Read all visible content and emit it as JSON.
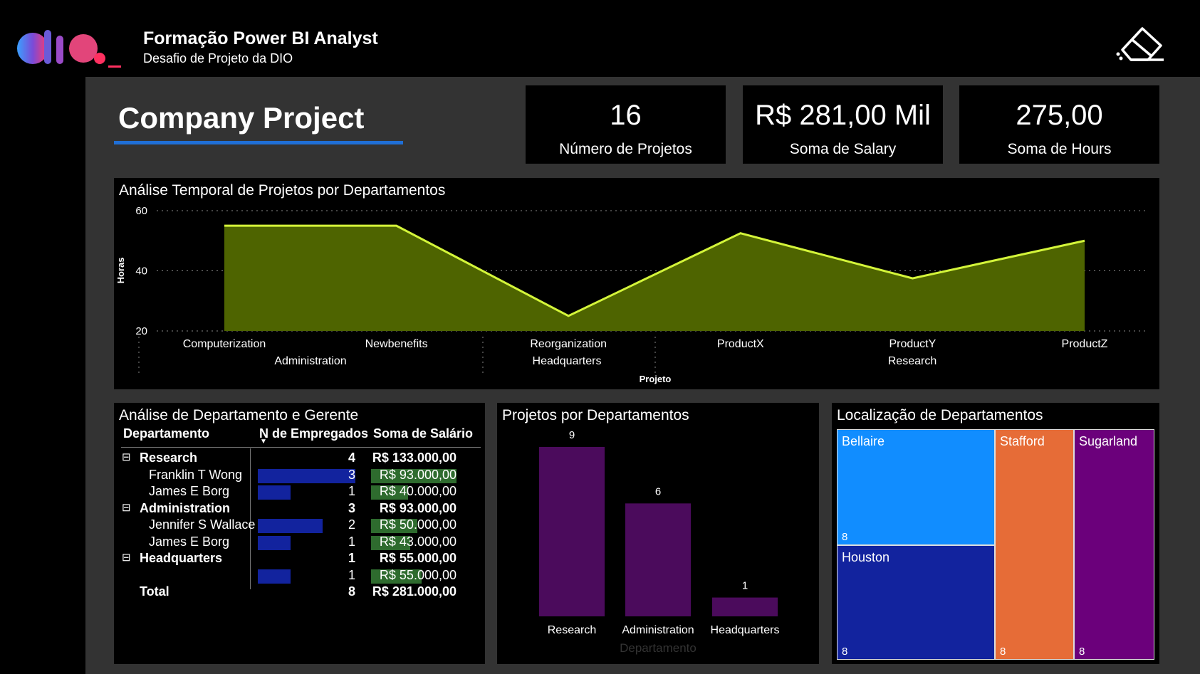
{
  "header": {
    "title": "Formação Power BI Analyst",
    "subtitle": "Desafio de Projeto da DIO",
    "logo_text": "dio",
    "eraser_icon": "eraser-icon"
  },
  "page": {
    "title": "Company Project"
  },
  "kpis": [
    {
      "value": "16",
      "label": "Número de Projetos"
    },
    {
      "value": "R$ 281,00 Mil",
      "label": "Soma de Salary"
    },
    {
      "value": "275,00",
      "label": "Soma de Hours"
    }
  ],
  "area_chart": {
    "title": "Análise Temporal de Projetos por Departamentos",
    "ylabel": "Horas",
    "xlabel": "Projeto",
    "y_ticks": [
      "60",
      "40",
      "20"
    ],
    "x_labels": [
      "Computerization",
      "Newbenefits",
      "Reorganization",
      "ProductX",
      "ProductY",
      "ProductZ"
    ],
    "group_labels": [
      "Administration",
      "Headquarters",
      "Research"
    ]
  },
  "table": {
    "title": "Análise de Departamento e Gerente",
    "columns": [
      "Departamento",
      "N de Empregados",
      "Soma de Salário"
    ],
    "rows": [
      {
        "name": "Research",
        "count": "4",
        "salary": "R$ 133.000,00",
        "level": "group",
        "expand": "⊟"
      },
      {
        "name": "Franklin T Wong",
        "count": "3",
        "salary": "R$ 93.000,00",
        "level": "child",
        "bar": 3,
        "salbar": 93000
      },
      {
        "name": "James E Borg",
        "count": "1",
        "salary": "R$ 40.000,00",
        "level": "child",
        "bar": 1,
        "salbar": 40000
      },
      {
        "name": "Administration",
        "count": "3",
        "salary": "R$ 93.000,00",
        "level": "group",
        "expand": "⊟"
      },
      {
        "name": "Jennifer S Wallace",
        "count": "2",
        "salary": "R$ 50.000,00",
        "level": "child",
        "bar": 2,
        "salbar": 50000
      },
      {
        "name": "James E Borg",
        "count": "1",
        "salary": "R$ 43.000,00",
        "level": "child",
        "bar": 1,
        "salbar": 43000
      },
      {
        "name": "Headquarters",
        "count": "1",
        "salary": "R$ 55.000,00",
        "level": "group",
        "expand": "⊟"
      },
      {
        "name": "",
        "count": "1",
        "salary": "R$ 55.000,00",
        "level": "child",
        "bar": 1,
        "salbar": 55000
      }
    ],
    "total": {
      "name": "Total",
      "count": "8",
      "salary": "R$ 281.000,00"
    }
  },
  "bar_chart": {
    "title": "Projetos por Departamentos",
    "xlabel": "Departamento"
  },
  "treemap": {
    "title": "Localização de Departamentos",
    "tiles": [
      {
        "name": "Bellaire",
        "count": "8",
        "color": "#118DFF"
      },
      {
        "name": "Houston",
        "count": "8",
        "color": "#12239E"
      },
      {
        "name": "Stafford",
        "count": "8",
        "color": "#E66C37"
      },
      {
        "name": "Sugarland",
        "count": "8",
        "color": "#6B007B"
      }
    ]
  },
  "colors": {
    "background": "#000000",
    "canvas": "#333333",
    "accent_line": "#D4F53A",
    "area_fill": "#4E6400",
    "bar_purple": "#4B0B5C",
    "table_bar_blue": "#12239E",
    "table_bar_green": "#2E6B2E",
    "title_underline": "#1F6FD6"
  },
  "chart_data": [
    {
      "type": "area",
      "title": "Análise Temporal de Projetos por Departamentos",
      "xlabel": "Projeto",
      "ylabel": "Horas",
      "categories": [
        "Computerization",
        "Administration",
        "Newbenefits",
        "Reorganization",
        "ProductX",
        "ProductY",
        "ProductZ"
      ],
      "values": [
        55,
        55,
        25,
        52.5,
        37.5,
        50
      ],
      "x": [
        "Computerization",
        "Newbenefits",
        "Reorganization",
        "ProductX",
        "ProductY",
        "ProductZ"
      ],
      "ylim": [
        20,
        60
      ],
      "grid": true
    },
    {
      "type": "bar",
      "title": "Projetos por Departamentos",
      "xlabel": "Departamento",
      "categories": [
        "Research",
        "Administration",
        "Headquarters"
      ],
      "values": [
        9,
        6,
        1
      ]
    },
    {
      "type": "table",
      "title": "Análise de Departamento e Gerente",
      "categories": [
        "Research",
        "Administration",
        "Headquarters"
      ],
      "values": [
        4,
        3,
        1
      ]
    }
  ]
}
